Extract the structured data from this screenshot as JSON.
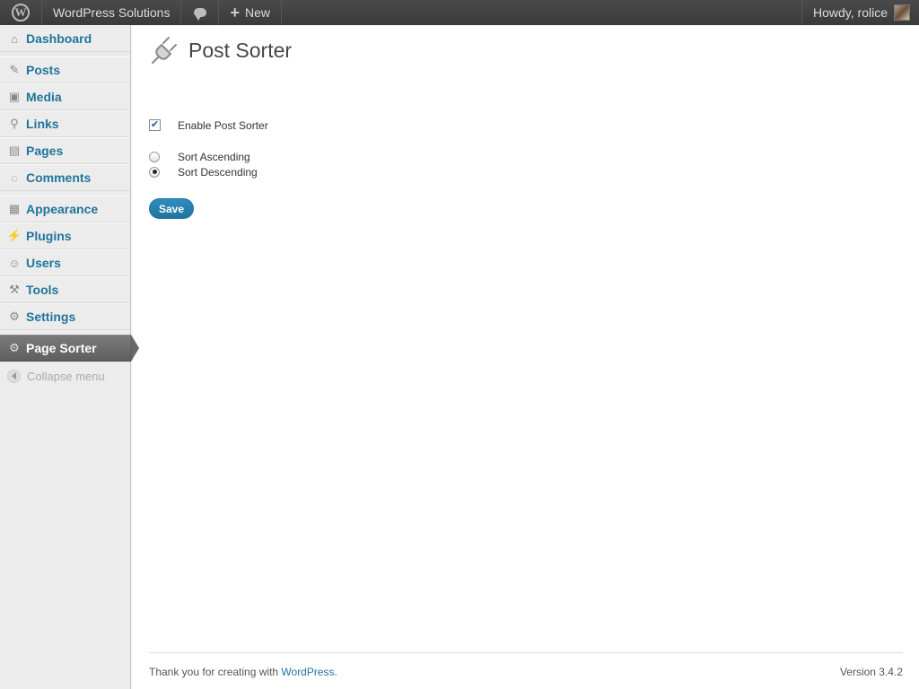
{
  "adminbar": {
    "site_name": "WordPress Solutions",
    "new_label": "New",
    "greeting": "Howdy, rolice",
    "wp_logo_icon": "wordpress-logo-icon",
    "comments_icon": "speech-bubble-icon",
    "plus_icon": "plus-icon"
  },
  "sidebar": {
    "items": [
      {
        "label": "Dashboard",
        "icon": "home-icon",
        "glyph": "⌂"
      },
      {
        "label": "Posts",
        "icon": "pushpin-icon",
        "glyph": "✎"
      },
      {
        "label": "Media",
        "icon": "media-icon",
        "glyph": "▣"
      },
      {
        "label": "Links",
        "icon": "link-icon",
        "glyph": "⚲"
      },
      {
        "label": "Pages",
        "icon": "pages-icon",
        "glyph": "▤"
      },
      {
        "label": "Comments",
        "icon": "comment-icon",
        "glyph": "◌"
      },
      {
        "label": "Appearance",
        "icon": "appearance-icon",
        "glyph": "▦"
      },
      {
        "label": "Plugins",
        "icon": "plugin-icon",
        "glyph": "⚡"
      },
      {
        "label": "Users",
        "icon": "users-icon",
        "glyph": "☺"
      },
      {
        "label": "Tools",
        "icon": "tools-icon",
        "glyph": "⚒"
      },
      {
        "label": "Settings",
        "icon": "settings-icon",
        "glyph": "⚙"
      },
      {
        "label": "Page Sorter",
        "icon": "gear-icon",
        "glyph": "⚙",
        "current": true
      }
    ],
    "collapse_label": "Collapse menu"
  },
  "main": {
    "title": "Post Sorter",
    "enable_label": "Enable Post Sorter",
    "enable_checked": true,
    "glyph_check": "✔",
    "sort_options": [
      {
        "label": "Sort Ascending",
        "selected": false
      },
      {
        "label": "Sort Descending",
        "selected": true
      }
    ],
    "save_label": "Save"
  },
  "footer": {
    "thanks_prefix": "Thank you for creating with ",
    "thanks_link": "WordPress",
    "thanks_suffix": ".",
    "version": "Version 3.4.2"
  },
  "colors": {
    "adminbar_bg": "#464646",
    "link": "#21759b",
    "current_menu_bg": "#6d6d6d",
    "sidebar_bg": "#ececec"
  }
}
